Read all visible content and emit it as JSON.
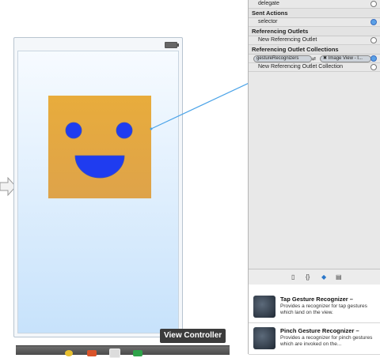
{
  "canvas": {
    "view_controller_label": "View Controller"
  },
  "connections": {
    "rows_top": [
      {
        "label": "delegate"
      }
    ],
    "sent_actions_header": "Sent Actions",
    "sent_actions": [
      {
        "label": "selector"
      }
    ],
    "referencing_outlets_header": "Referencing Outlets",
    "referencing_outlets": [
      {
        "label": "New Referencing Outlet"
      }
    ],
    "outlet_collections_header": "Referencing Outlet Collections",
    "outlet_collection_source": "gestureRecognizers",
    "outlet_collection_target": "Image View - I...",
    "new_collection_label": "New Referencing Outlet Collection"
  },
  "library": {
    "items": [
      {
        "title": "Tap Gesture Recognizer –",
        "description": "Provides a recognizer for tap gestures which land on the view."
      },
      {
        "title": "Pinch Gesture Recognizer –",
        "description": "Provides a recognizer for pinch gestures which are invoked on the..."
      }
    ]
  },
  "colors": {
    "image_bg": "#e4a843",
    "face_features": "#1f3cf0",
    "connection_line": "#4aa3e8"
  },
  "icons": [
    "entry-arrow-icon",
    "battery-icon",
    "file-icon",
    "braces-icon",
    "cube-icon",
    "grid-icon"
  ]
}
